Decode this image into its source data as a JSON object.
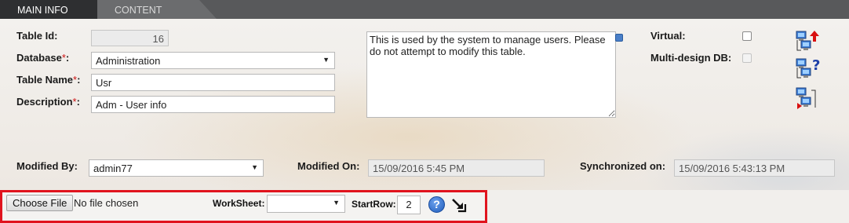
{
  "tabs": [
    {
      "label": "MAIN INFO",
      "active": true
    },
    {
      "label": "CONTENT",
      "active": false
    }
  ],
  "form": {
    "table_id": {
      "label": "Table Id:",
      "value": "16"
    },
    "database": {
      "label": "Database",
      "required_mark": "*",
      "suffix": ":",
      "value": "Administration"
    },
    "table_name": {
      "label": "Table Name",
      "required_mark": "*",
      "suffix": ":",
      "value": "Usr"
    },
    "description": {
      "label": "Description",
      "required_mark": "*",
      "suffix": ":",
      "value": "Adm - User info"
    },
    "notes": "This is used by the system to manage users. Please do not attempt to modify this table.",
    "virtual": {
      "label": "Virtual:",
      "checked": false
    },
    "multi_design": {
      "label": "Multi-design DB:",
      "checked": false,
      "disabled": true
    },
    "modified_by": {
      "label": "Modified By:",
      "value": "admin77"
    },
    "modified_on": {
      "label": "Modified On:",
      "value": "15/09/2016 5:45 PM"
    },
    "synchronized_on": {
      "label": "Synchronized on:",
      "value": "15/09/2016 5:43:13 PM"
    }
  },
  "actions": [
    {
      "icon": "network-upload-icon"
    },
    {
      "icon": "network-help-icon"
    },
    {
      "icon": "network-download-icon"
    }
  ],
  "import": {
    "choose_file_label": "Choose File",
    "no_file_text": "No file chosen",
    "worksheet_label": "WorkSheet:",
    "worksheet_value": "",
    "start_row_label": "StartRow:",
    "start_row_value": "2",
    "help_glyph": "?"
  },
  "colors": {
    "tab_active": "#2e2f31",
    "tab_inactive": "#6b6c6e",
    "required": "#cc1111",
    "highlight_border": "#e0141e"
  }
}
